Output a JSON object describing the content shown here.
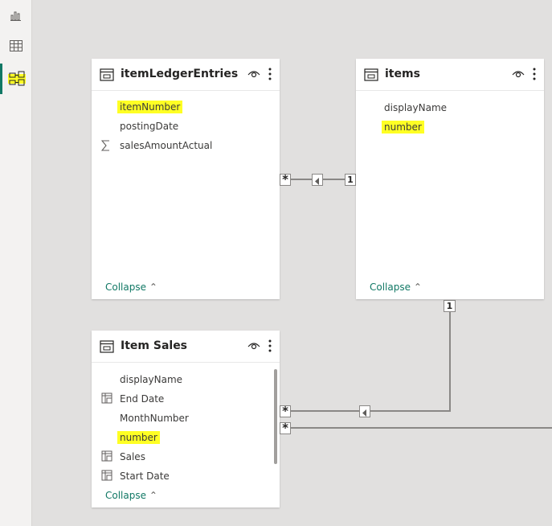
{
  "sidebar": {
    "items": [
      {
        "name": "report-view",
        "icon": "bar-chart-icon"
      },
      {
        "name": "data-view",
        "icon": "grid-icon"
      },
      {
        "name": "model-view",
        "icon": "model-icon",
        "active": true
      }
    ]
  },
  "tables": {
    "ledger": {
      "title": "itemLedgerEntries",
      "fields": [
        "itemNumber",
        "postingDate",
        "salesAmountActual"
      ],
      "collapse": "Collapse"
    },
    "items": {
      "title": "items",
      "fields": [
        "displayName",
        "number"
      ],
      "collapse": "Collapse"
    },
    "sales": {
      "title": "Item Sales",
      "fields": [
        "displayName",
        "End Date",
        "MonthNumber",
        "number",
        "Sales",
        "Start Date"
      ],
      "collapse": "Collapse"
    }
  },
  "relationships": {
    "ledger_items": {
      "from": "*",
      "to": "1"
    },
    "items_sales": {
      "from": "1",
      "to": "*"
    },
    "sales_offscreen": {
      "from": "*"
    }
  },
  "colors": {
    "highlight": "#ffff24",
    "accent": "#117865",
    "line": "#8a8886"
  }
}
